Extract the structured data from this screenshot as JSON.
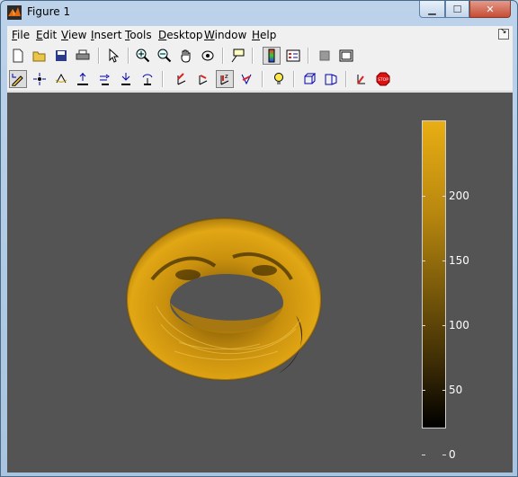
{
  "window": {
    "title": "Figure 1"
  },
  "menu": [
    "File",
    "Edit",
    "View",
    "Insert",
    "Tools",
    "Desktop",
    "Window",
    "Help"
  ],
  "toolbar1": [
    "new-figure-icon",
    "open-file-icon",
    "save-icon",
    "print-icon",
    "select-pointer-icon",
    "zoom-in-icon",
    "zoom-out-icon",
    "pan-hand-icon",
    "rotate-3d-icon",
    "data-cursor-icon",
    "colorbar-icon",
    "legend-icon",
    "hide-plot-tools-icon",
    "show-plot-tools-icon"
  ],
  "toolbar2": [
    "edit-plot-icon",
    "scatter-icon",
    "orbit-camera-icon",
    "dolly-camera-icon",
    "move-camera-icon",
    "zoom-camera-icon",
    "roll-camera-icon",
    "x-axis-icon",
    "y-axis-icon",
    "z-axis-icon",
    "no-axis-icon",
    "light-icon",
    "orthographic-icon",
    "perspective-icon",
    "reset-camera-icon",
    "stop-icon"
  ],
  "colorbar": {
    "ticks": [
      "0",
      "50",
      "100",
      "150",
      "200"
    ],
    "colormap": [
      "#000000",
      "#7a5a0a",
      "#e9ae14"
    ]
  },
  "colors": {
    "axes_background": "#545454",
    "surface": "#c9900e"
  }
}
